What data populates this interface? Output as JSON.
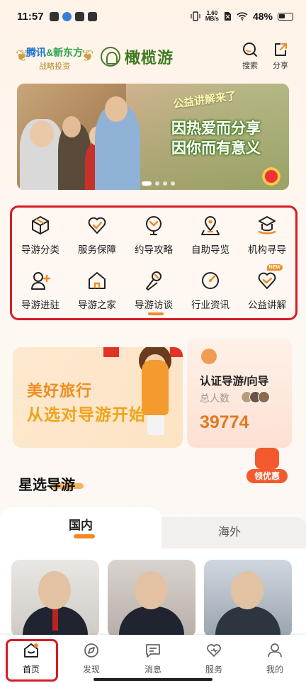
{
  "status_bar": {
    "time": "11:57",
    "net_speed_value": "1.60",
    "net_speed_unit": "MB/s",
    "battery": "48%"
  },
  "header": {
    "partner_tencent": "腾讯",
    "partner_amp": "&",
    "partner_xdf": "新东方",
    "partner_sub": "战略投资",
    "logo_text": "橄榄游",
    "search_label": "搜索",
    "share_label": "分享"
  },
  "banner": {
    "tagline": "公益讲解来了",
    "line1": "因热爱而分享",
    "line2": "因你而有意义"
  },
  "categories": [
    {
      "label": "导游分类",
      "icon": "box-icon"
    },
    {
      "label": "服务保障",
      "icon": "heart-check-icon"
    },
    {
      "label": "约导攻略",
      "icon": "compass-icon"
    },
    {
      "label": "自助导览",
      "icon": "map-pin-icon"
    },
    {
      "label": "机构寻导",
      "icon": "building-icon"
    },
    {
      "label": "导游进驻",
      "icon": "user-add-icon"
    },
    {
      "label": "导游之家",
      "icon": "home-icon"
    },
    {
      "label": "导游访谈",
      "icon": "microphone-icon"
    },
    {
      "label": "行业资讯",
      "icon": "info-dial-icon"
    },
    {
      "label": "公益讲解",
      "icon": "heart-hands-icon",
      "badge": "NEW"
    }
  ],
  "promo": {
    "left_line1": "美好旅行",
    "left_line2": "从选对导游开始",
    "right_title": "认证导游/向导",
    "right_label": "总人数",
    "right_count": "39774",
    "coupon": "领优惠"
  },
  "section": {
    "title": "星选导游"
  },
  "tabs": {
    "domestic": "国内",
    "abroad": "海外"
  },
  "tabbar": {
    "home": "首页",
    "discover": "发现",
    "message": "消息",
    "service": "服务",
    "mine": "我的"
  },
  "colors": {
    "accent": "#f08a24",
    "highlight_border": "#d61c26",
    "brand_green": "#3f7a22"
  }
}
